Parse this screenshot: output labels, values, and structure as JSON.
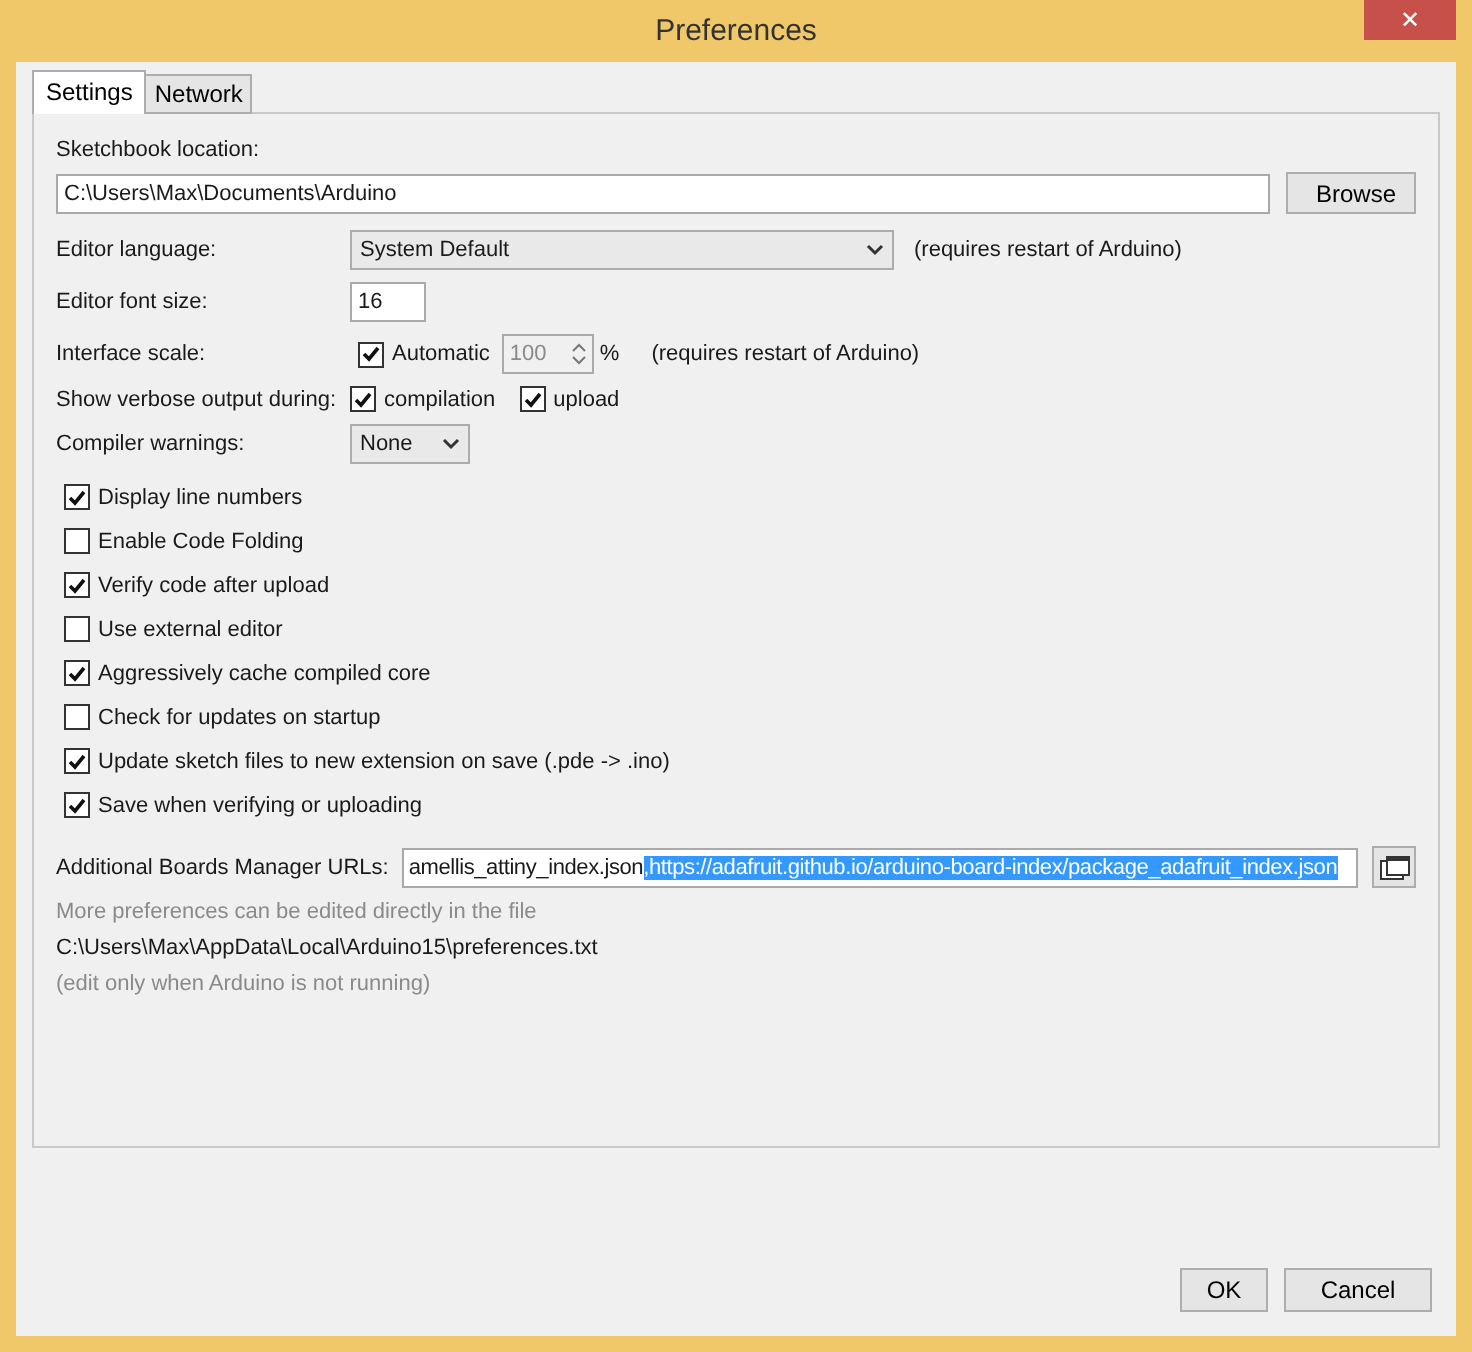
{
  "window": {
    "title": "Preferences",
    "close": "✕"
  },
  "tabs": [
    {
      "label": "Settings",
      "selected": true
    },
    {
      "label": "Network",
      "selected": false
    }
  ],
  "sketchbook": {
    "label": "Sketchbook location:",
    "value": "C:\\Users\\Max\\Documents\\Arduino",
    "button": "Browse"
  },
  "editor_language": {
    "label": "Editor language:",
    "value": "System Default",
    "note": "(requires restart of Arduino)"
  },
  "editor_font_size": {
    "label": "Editor font size:",
    "value": "16"
  },
  "interface_scale": {
    "label": "Interface scale:",
    "automatic": {
      "label": "Automatic",
      "checked": true
    },
    "value": "100",
    "unit": "%",
    "disabled": true,
    "note": "(requires restart of Arduino)"
  },
  "verbose_output": {
    "label": "Show verbose output during:",
    "options": [
      {
        "label": "compilation",
        "checked": true
      },
      {
        "label": "upload",
        "checked": true
      }
    ]
  },
  "compiler_warnings": {
    "label": "Compiler warnings:",
    "value": "None"
  },
  "options": [
    {
      "label": "Display line numbers",
      "checked": true
    },
    {
      "label": "Enable Code Folding",
      "checked": false
    },
    {
      "label": "Verify code after upload",
      "checked": true
    },
    {
      "label": "Use external editor",
      "checked": false
    },
    {
      "label": "Aggressively cache compiled core",
      "checked": true
    },
    {
      "label": "Check for updates on startup",
      "checked": false
    },
    {
      "label": "Update sketch files to new extension on save (.pde -> .ino)",
      "checked": true
    },
    {
      "label": "Save when verifying or uploading",
      "checked": true
    }
  ],
  "boards_urls": {
    "label": "Additional Boards Manager URLs:",
    "value_before": "amellis_attiny_index.json",
    "selected_text": ",https://adafruit.github.io/arduino-board-index/package_adafruit_index.json"
  },
  "notes": [
    {
      "text": "More preferences can be edited directly in the file",
      "muted": true
    },
    {
      "text": "C:\\Users\\Max\\AppData\\Local\\Arduino15\\preferences.txt",
      "muted": false
    },
    {
      "text": "(edit only when Arduino is not running)",
      "muted": true
    }
  ],
  "buttons": [
    "OK",
    "Cancel"
  ]
}
